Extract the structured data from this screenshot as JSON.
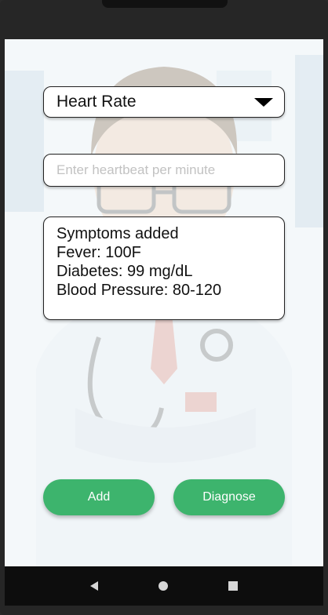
{
  "vitals_select": {
    "selected": "Heart Rate"
  },
  "heartbeat_input": {
    "placeholder": "Enter heartbeat per minute",
    "value": ""
  },
  "symptoms_panel": {
    "lines": [
      "Symptoms added",
      "Fever: 100F",
      "Diabetes: 99 mg/dL",
      "Blood Pressure: 80-120"
    ]
  },
  "actions": {
    "add_label": "Add",
    "diagnose_label": "Diagnose"
  },
  "nav": {
    "back": "back-icon",
    "home": "home-icon",
    "recent": "recent-apps-icon"
  },
  "colors": {
    "primary": "#3db46d"
  }
}
